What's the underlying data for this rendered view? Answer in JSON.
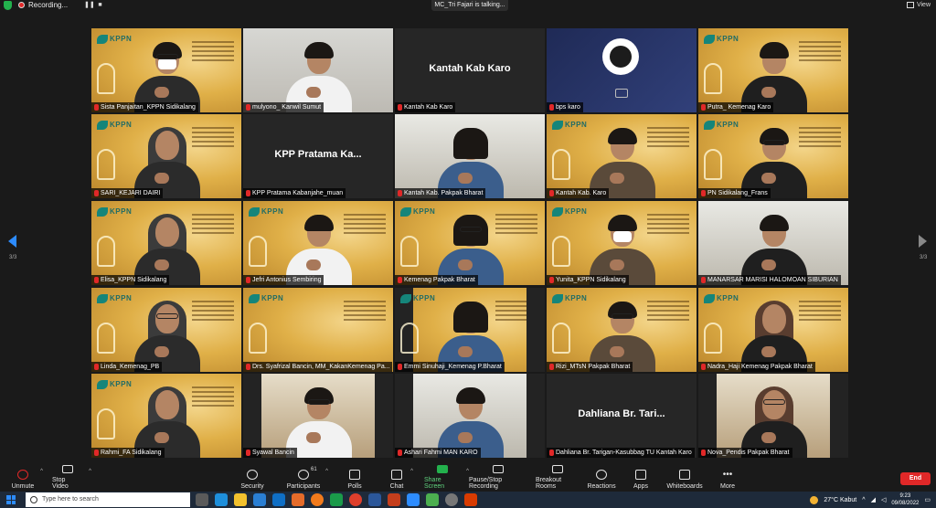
{
  "topbar": {
    "recording_label": "Recording...",
    "talking_label": "MC_Tri Fajari is talking...",
    "view_label": "View"
  },
  "pagination": {
    "left_label": "3/3",
    "right_label": "3/3"
  },
  "tiles": [
    {
      "name": "Sista Panjaitan_KPPN Sidikalang",
      "style": "gold",
      "person": "mask"
    },
    {
      "name": "mulyono_ Kanwil Sumut",
      "style": "photo",
      "person": "man"
    },
    {
      "name": "Kantah Kab Karo",
      "style": "gray",
      "center_text": "Kantah Kab Karo"
    },
    {
      "name": "bps karo",
      "style": "navy",
      "person": "none"
    },
    {
      "name": "Putra_ Kemenag Karo",
      "style": "gold",
      "person": "man"
    },
    {
      "name": "SARI_KEJARI DAIRI",
      "style": "gold",
      "person": "hijab"
    },
    {
      "name": "KPP Pratama Kabanjahe_muan",
      "style": "gray",
      "center_text": "KPP Pratama Ka..."
    },
    {
      "name": "Kantah Kab. Pakpak Bharat",
      "style": "room",
      "person": "woman"
    },
    {
      "name": "Kantah Kab. Karo",
      "style": "gold",
      "person": "man"
    },
    {
      "name": "PN Sidikalang_Frans",
      "style": "gold",
      "person": "man"
    },
    {
      "name": "Elisa_KPPN Sidikalang",
      "style": "gold",
      "person": "hijab"
    },
    {
      "name": "Jefri Antonius Sembiring",
      "style": "gold",
      "person": "man"
    },
    {
      "name": "Kemenag Pakpak Bharat",
      "style": "gold",
      "person": "woman"
    },
    {
      "name": "Yunita_KPPN Sidikalang",
      "style": "gold",
      "person": "mask"
    },
    {
      "name": "MANARSAR MARISI HALOMOAN SIBURIAN",
      "style": "room",
      "person": "man"
    },
    {
      "name": "Linda_Kemenag_PB",
      "style": "gold",
      "person": "hijab"
    },
    {
      "name": "Drs. Syafrizal Bancin, MM_KakanKemenag Pa...",
      "style": "gold",
      "person": "none"
    },
    {
      "name": "Emmi Sinuhaji_Kemenag P.Bharat",
      "style": "gold",
      "person": "woman"
    },
    {
      "name": "Rizi_MTsN Pakpak Bharat",
      "style": "gold",
      "person": "man"
    },
    {
      "name": "Nadra_Haji Kemenag Pakpak Bharat",
      "style": "gold",
      "person": "hijab"
    },
    {
      "name": "Rahmi_FA Sidikalang",
      "style": "gold",
      "person": "hijab"
    },
    {
      "name": "Syawal Bancin",
      "style": "window",
      "person": "man"
    },
    {
      "name": "Ashari Fahmi MAN KARO",
      "style": "room",
      "person": "man"
    },
    {
      "name": "Dahliana Br. Tarigan-Kasubbag TU Kantah Karo",
      "style": "gray",
      "center_text": "Dahliana Br. Tari..."
    },
    {
      "name": "Nova_Pendis Pakpak Bharat",
      "style": "window",
      "person": "hijab"
    }
  ],
  "toolbar": {
    "unmute": "Unmute",
    "stop_video": "Stop Video",
    "security": "Security",
    "participants": "Participants",
    "participants_count": "61",
    "polls": "Polls",
    "chat": "Chat",
    "share_screen": "Share Screen",
    "pause_recording": "Pause/Stop Recording",
    "breakout_rooms": "Breakout Rooms",
    "reactions": "Reactions",
    "apps": "Apps",
    "whiteboards": "Whiteboards",
    "more": "More",
    "end": "End"
  },
  "taskbar": {
    "search_placeholder": "Type here to search",
    "weather": "27°C  Kabut",
    "time": "9:23",
    "date": "09/08/2022"
  },
  "colors": {
    "accent_blue": "#2d8cff",
    "end_red": "#e02828",
    "share_green": "#23b14d",
    "tile_gold": "#e0b048"
  }
}
